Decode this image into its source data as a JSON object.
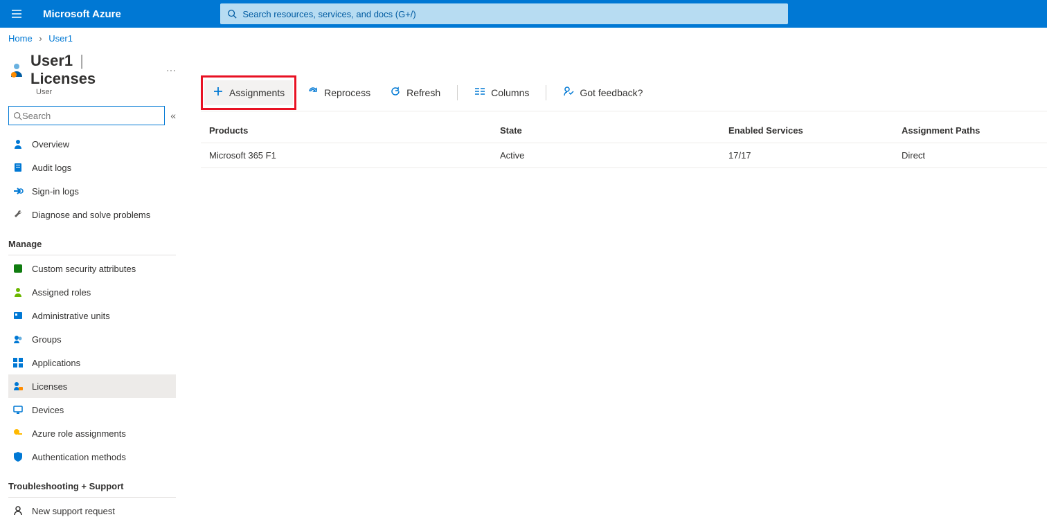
{
  "header": {
    "brand": "Microsoft Azure",
    "search_placeholder": "Search resources, services, and docs (G+/)"
  },
  "breadcrumbs": {
    "home": "Home",
    "user": "User1"
  },
  "page": {
    "title_user": "User1",
    "title_sep": "|",
    "title_page": "Licenses",
    "subtitle": "User",
    "more": "···"
  },
  "sidebar": {
    "search_placeholder": "Search",
    "collapse": "«",
    "items1": {
      "overview": "Overview",
      "audit": "Audit logs",
      "signin": "Sign-in logs",
      "diag": "Diagnose and solve problems"
    },
    "manage_header": "Manage",
    "items2": {
      "csa": "Custom security attributes",
      "roles": "Assigned roles",
      "au": "Administrative units",
      "groups": "Groups",
      "apps": "Applications",
      "licenses": "Licenses",
      "devices": "Devices",
      "azra": "Azure role assignments",
      "auth": "Authentication methods"
    },
    "ts_header": "Troubleshooting + Support",
    "items3": {
      "support": "New support request"
    }
  },
  "toolbar": {
    "assignments": "Assignments",
    "reprocess": "Reprocess",
    "refresh": "Refresh",
    "columns": "Columns",
    "feedback": "Got feedback?"
  },
  "table": {
    "headers": {
      "products": "Products",
      "state": "State",
      "es": "Enabled Services",
      "ap": "Assignment Paths"
    },
    "row0": {
      "product": "Microsoft 365 F1",
      "state": "Active",
      "es": "17/17",
      "ap": "Direct"
    }
  }
}
